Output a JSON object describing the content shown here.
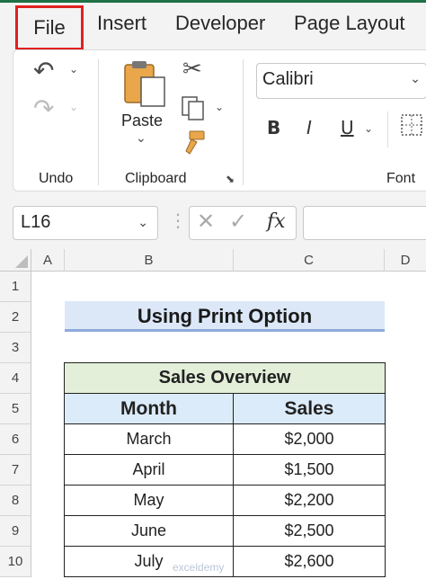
{
  "tabs": [
    "File",
    "Insert",
    "Developer",
    "Page Layout"
  ],
  "ribbon": {
    "undo_group": "Undo",
    "paste_label": "Paste",
    "clipboard_group": "Clipboard",
    "font_group": "Font",
    "font_name": "Calibri",
    "bold": "B",
    "italic": "I",
    "underline": "U"
  },
  "formula_bar": {
    "name_box": "L16",
    "fx": "fx",
    "formula": ""
  },
  "columns": [
    "A",
    "B",
    "C",
    "D"
  ],
  "rows": [
    "1",
    "2",
    "3",
    "4",
    "5",
    "6",
    "7",
    "8",
    "9",
    "10"
  ],
  "sheet": {
    "title": "Using Print Option",
    "table_caption": "Sales Overview",
    "headers": [
      "Month",
      "Sales"
    ],
    "rows": [
      [
        "March",
        "$2,000"
      ],
      [
        "April",
        "$1,500"
      ],
      [
        "May",
        "$2,200"
      ],
      [
        "June",
        "$2,500"
      ],
      [
        "July",
        "$2,600"
      ]
    ]
  },
  "watermark": "exceldemy",
  "colors": {
    "accent": "#1e7145",
    "highlight_border": "#e02020",
    "title_fill": "#dce8f7",
    "caption_fill": "#e3efd9",
    "header_fill": "#dcebf9"
  }
}
